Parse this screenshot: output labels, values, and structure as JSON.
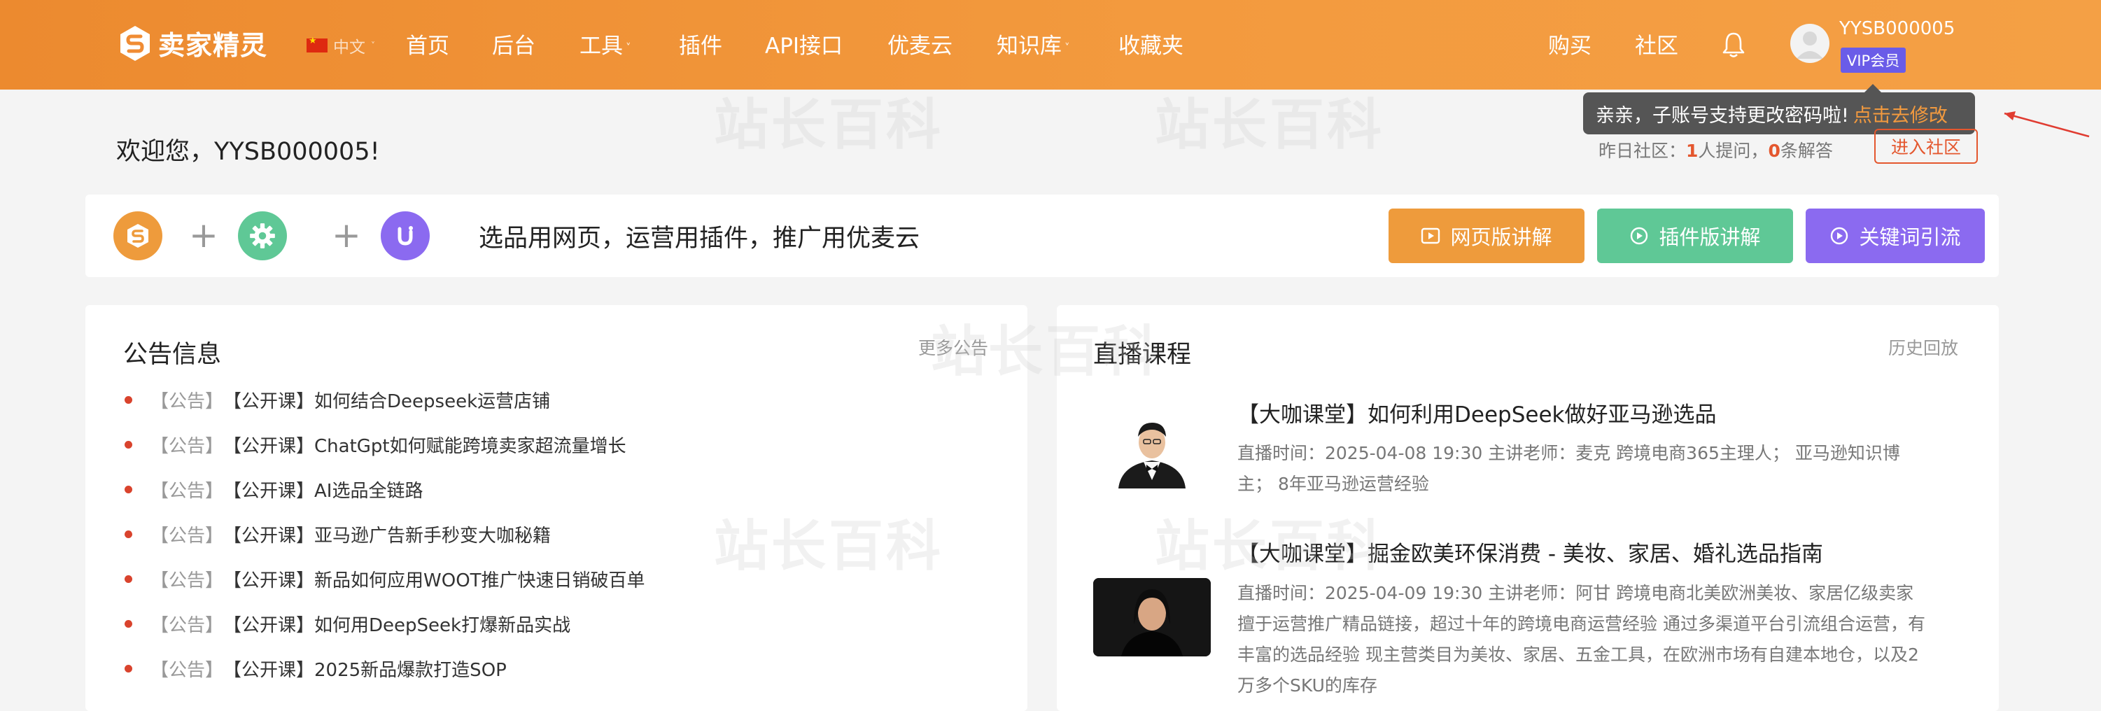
{
  "header": {
    "brand": "卖家精灵",
    "language": "中文",
    "nav": [
      {
        "label": "首页",
        "has_caret": false
      },
      {
        "label": "后台",
        "has_caret": false
      },
      {
        "label": "工具",
        "has_caret": true
      },
      {
        "label": "插件",
        "has_caret": false
      },
      {
        "label": "API接口",
        "has_caret": false
      },
      {
        "label": "优麦云",
        "has_caret": false
      },
      {
        "label": "知识库",
        "has_caret": true
      },
      {
        "label": "收藏夹",
        "has_caret": false
      }
    ],
    "right_nav": [
      "购买",
      "社区"
    ],
    "username": "YYSB000005",
    "vip_badge": "VIP会员"
  },
  "welcome": {
    "text": "欢迎您，YYSB000005!",
    "tooltip_text": "亲亲，子账号支持更改密码啦!",
    "tooltip_link": "点击去修改",
    "stats_prefix": "昨日社区：",
    "questions_count": "1",
    "questions_label": "人提问，",
    "answers_count": "0",
    "answers_label": "条解答",
    "enter_community": "进入社区"
  },
  "promo": {
    "text": "选品用网页，运营用插件，推广用优麦云",
    "buttons": [
      {
        "label": "网页版讲解",
        "color": "#ee9b3c"
      },
      {
        "label": "插件版讲解",
        "color": "#5fc896"
      },
      {
        "label": "关键词引流",
        "color": "#8b6af0"
      }
    ]
  },
  "announcements": {
    "title": "公告信息",
    "more": "更多公告",
    "tag": "【公告】",
    "items": [
      "【公开课】如何结合Deepseek运营店铺",
      "【公开课】ChatGpt如何赋能跨境卖家超流量增长",
      "【公开课】AI选品全链路",
      "【公开课】亚马逊广告新手秒变大咖秘籍",
      "【公开课】新品如何应用WOOT推广快速日销破百单",
      "【公开课】如何用DeepSeek打爆新品实战",
      "【公开课】2025新品爆款打造SOP"
    ]
  },
  "live": {
    "title": "直播课程",
    "more": "历史回放",
    "courses": [
      {
        "title": "【大咖课堂】如何利用DeepSeek做好亚马逊选品",
        "line1": "直播时间：2025-04-08 19:30    主讲老师：麦克  跨境电商365主理人；  亚马逊知识博",
        "line2": "主；  8年亚马逊运营经验"
      },
      {
        "title": "【大咖课堂】掘金欧美环保消费 - 美妆、家居、婚礼选品指南",
        "line1": "直播时间：2025-04-09 19:30    主讲老师：阿甘  跨境电商北美欧洲美妆、家居亿级卖家",
        "line2": "擅于运营推广精品链接，超过十年的跨境电商运营经验  通过多渠道平台引流组合运营，有",
        "line3": "丰富的选品经验  现主营类目为美妆、家居、五金工具，在欧洲市场有自建本地仓，以及2",
        "line4": "万多个SKU的库存"
      }
    ]
  },
  "watermark": "站长百科",
  "colors": {
    "orange": "#f39a3e",
    "green": "#5fc896",
    "purple": "#8b6af0",
    "red": "#e4572e"
  }
}
